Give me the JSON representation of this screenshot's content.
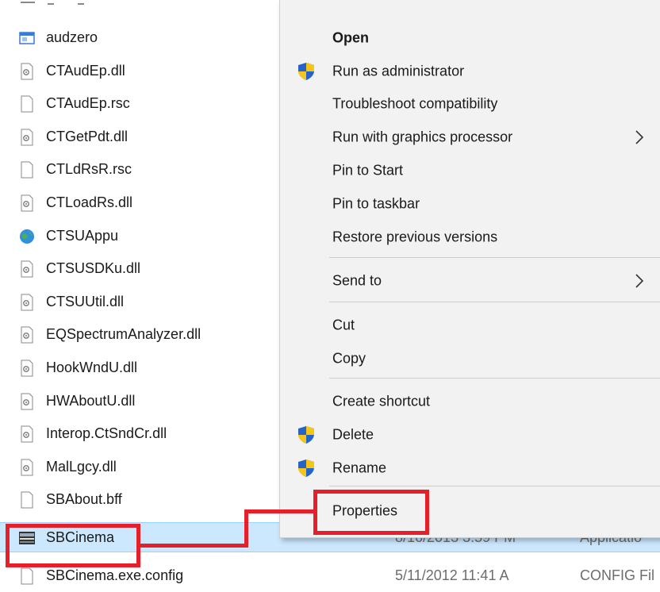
{
  "files": [
    {
      "name": "audzero",
      "icon": "app-window-icon"
    },
    {
      "name": "CTAudEp.dll",
      "icon": "dll-file-icon"
    },
    {
      "name": "CTAudEp.rsc",
      "icon": "blank-file-icon"
    },
    {
      "name": "CTGetPdt.dll",
      "icon": "dll-file-icon"
    },
    {
      "name": "CTLdRsR.rsc",
      "icon": "blank-file-icon"
    },
    {
      "name": "CTLoadRs.dll",
      "icon": "dll-file-icon"
    },
    {
      "name": "CTSUAppu",
      "icon": "globe-update-icon"
    },
    {
      "name": "CTSUSDKu.dll",
      "icon": "dll-file-icon"
    },
    {
      "name": "CTSUUtil.dll",
      "icon": "dll-file-icon"
    },
    {
      "name": "EQSpectrumAnalyzer.dll",
      "icon": "dll-file-icon"
    },
    {
      "name": "HookWndU.dll",
      "icon": "dll-file-icon"
    },
    {
      "name": "HWAboutU.dll",
      "icon": "dll-file-icon"
    },
    {
      "name": "Interop.CtSndCr.dll",
      "icon": "dll-file-icon"
    },
    {
      "name": "MalLgcy.dll",
      "icon": "dll-file-icon"
    },
    {
      "name": "SBAbout.bff",
      "icon": "blank-file-icon"
    },
    {
      "name": "SBCinema",
      "icon": "checkmark-icon"
    }
  ],
  "selected_file": {
    "name": "SBCinema",
    "date": "8/16/2013 3:59 PM",
    "type": "Applicatio",
    "icon": "sbcinema-app-icon"
  },
  "partial_row": {
    "name": "SBCinema.exe.config",
    "date": "5/11/2012 11:41 A",
    "type": "CONFIG Fil"
  },
  "context_menu": {
    "open": "Open",
    "run_as_admin": "Run as administrator",
    "troubleshoot": "Troubleshoot compatibility",
    "run_with_gpu": "Run with graphics processor",
    "pin_start": "Pin to Start",
    "pin_taskbar": "Pin to taskbar",
    "restore_versions": "Restore previous versions",
    "send_to": "Send to",
    "cut": "Cut",
    "copy": "Copy",
    "create_shortcut": "Create shortcut",
    "delete": "Delete",
    "rename": "Rename",
    "properties": "Properties"
  },
  "colors": {
    "selection": "#cce8ff",
    "highlight": "#e6202a",
    "menu_bg": "#f2f2f2",
    "shield_blue": "#2563c9",
    "shield_yellow": "#f5c518"
  }
}
